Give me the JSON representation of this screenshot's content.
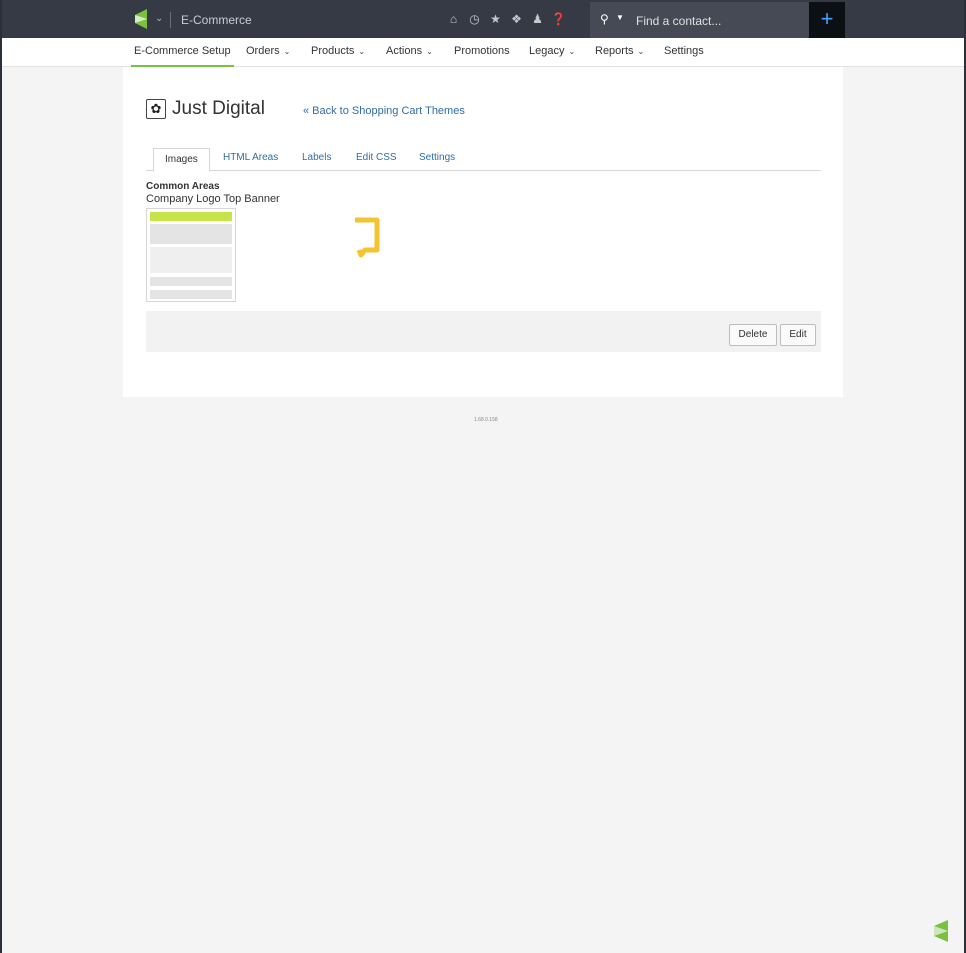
{
  "topbar": {
    "app_name": "E-Commerce",
    "icons": [
      "home-icon",
      "history-icon",
      "star-icon",
      "tag-icon",
      "user-icon",
      "help-icon"
    ],
    "search": {
      "placeholder": "Find a contact..."
    },
    "add_button": "+"
  },
  "nav": {
    "items": [
      {
        "label": "E-Commerce Setup",
        "active": true,
        "dropdown": false
      },
      {
        "label": "Orders",
        "dropdown": true
      },
      {
        "label": "Products",
        "dropdown": true
      },
      {
        "label": "Actions",
        "dropdown": true
      },
      {
        "label": "Promotions",
        "dropdown": false
      },
      {
        "label": "Legacy",
        "dropdown": true
      },
      {
        "label": "Reports",
        "dropdown": true
      },
      {
        "label": "Settings",
        "dropdown": false
      }
    ]
  },
  "page": {
    "title": "Just Digital",
    "back_link": "« Back to Shopping Cart Themes"
  },
  "tabs": [
    {
      "label": "Images",
      "active": true
    },
    {
      "label": "HTML Areas"
    },
    {
      "label": "Labels"
    },
    {
      "label": "Edit CSS"
    },
    {
      "label": "Settings"
    }
  ],
  "content": {
    "section_heading": "Common Areas",
    "area_label": "Company Logo Top Banner"
  },
  "actions": {
    "delete_label": "Delete",
    "edit_label": "Edit"
  },
  "footer": {
    "version": "1.68.0.158"
  },
  "colors": {
    "accent": "#7ac142",
    "link": "#2f6ea6",
    "topbar": "#363a45",
    "spinner": "#f4c430"
  }
}
